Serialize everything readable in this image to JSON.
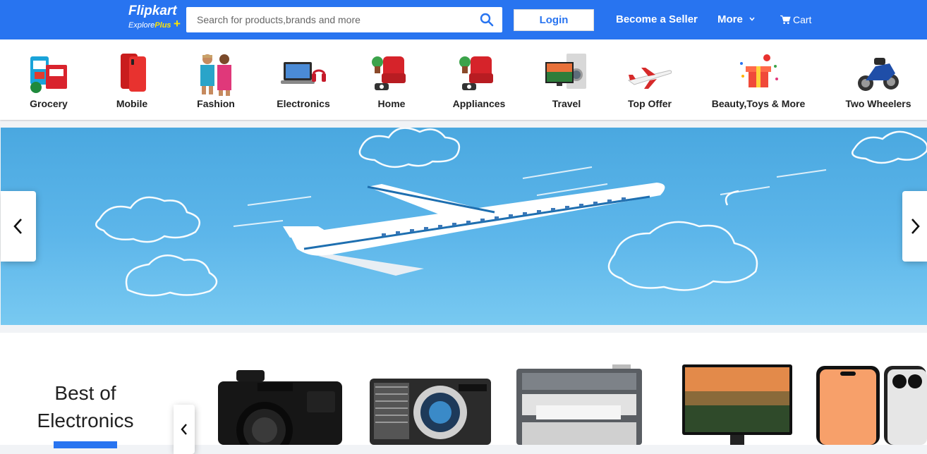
{
  "header": {
    "logo_text": "Flipkart",
    "logo_sub_prefix": "Explore",
    "logo_sub_plus": "Plus",
    "logo_plus_sign": "+",
    "search_placeholder": "Search for products,brands and more",
    "login_label": "Login",
    "seller_label": "Become a Seller",
    "more_label": "More",
    "cart_label": "Cart"
  },
  "categories": [
    {
      "label": "Grocery"
    },
    {
      "label": "Mobile"
    },
    {
      "label": "Fashion"
    },
    {
      "label": "Electronics"
    },
    {
      "label": "Home"
    },
    {
      "label": "Appliances"
    },
    {
      "label": "Travel"
    },
    {
      "label": "Top Offer"
    },
    {
      "label": "Beauty,Toys & More"
    },
    {
      "label": "Two Wheelers"
    }
  ],
  "section": {
    "title_line1": "Best of",
    "title_line2": "Electronics"
  },
  "colors": {
    "brand": "#2874f0",
    "accent_yellow": "#ffe500",
    "banner_sky": "#5db6ea"
  },
  "icons": [
    "search-icon",
    "chevron-down-icon",
    "cart-icon",
    "chevron-left-icon",
    "chevron-right-icon"
  ]
}
